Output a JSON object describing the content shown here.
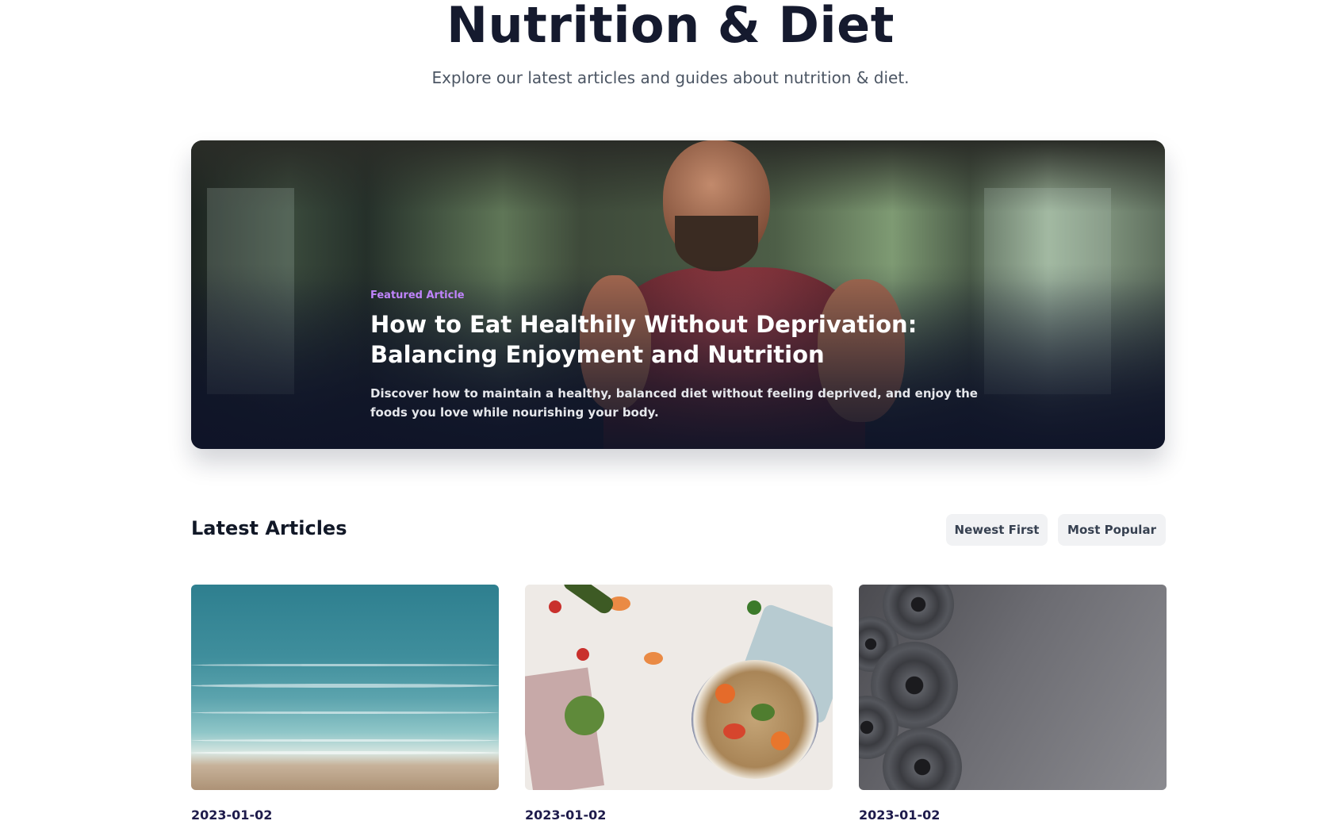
{
  "header": {
    "title": "Nutrition & Diet",
    "subtitle": "Explore our latest articles and guides about nutrition & diet."
  },
  "featured": {
    "tag": "Featured Article",
    "title": "How to Eat Healthily Without Deprivation: Balancing Enjoyment and Nutrition",
    "description": "Discover how to maintain a healthy, balanced diet without feeling deprived, and enjoy the foods you love while nourishing your body."
  },
  "latest": {
    "title": "Latest Articles",
    "sort_options": [
      "Newest First",
      "Most Popular"
    ]
  },
  "cards": [
    {
      "date": "2023-01-02",
      "image": "ocean-waves-image"
    },
    {
      "date": "2023-01-02",
      "image": "healthy-food-bowl-image"
    },
    {
      "date": "2023-01-02",
      "image": "weight-plates-image"
    }
  ]
}
